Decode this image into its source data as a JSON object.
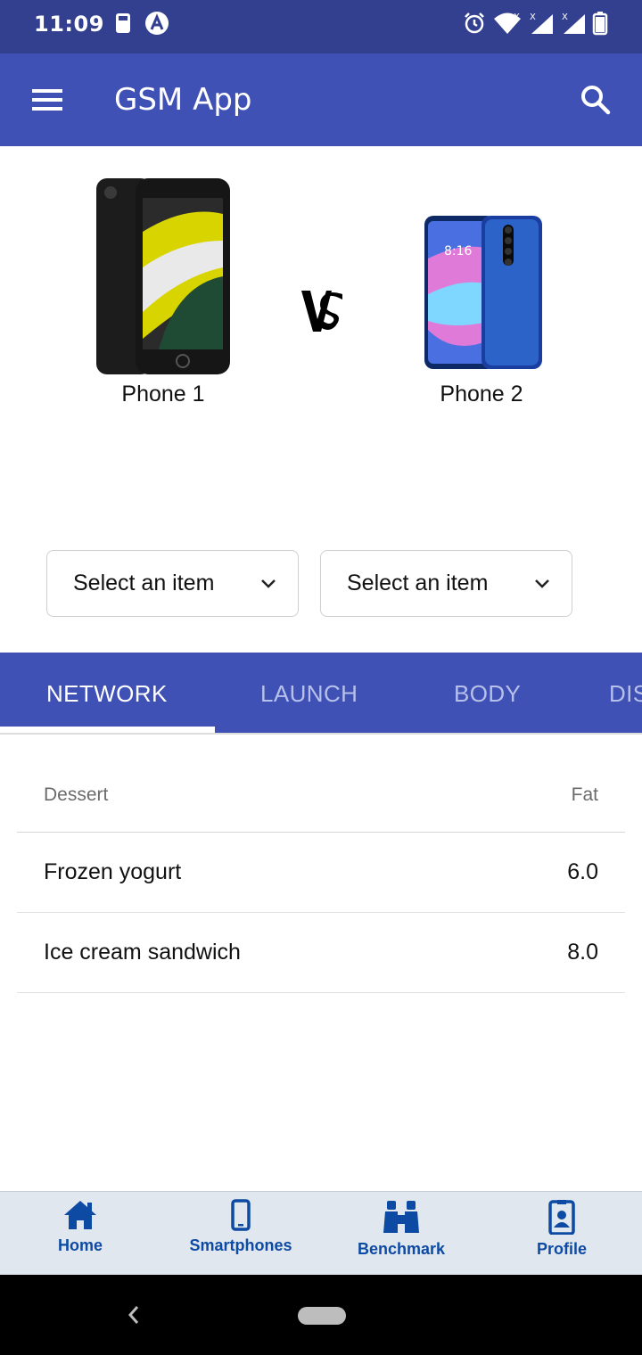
{
  "status_bar": {
    "time": "11:09",
    "icons": [
      "sim-card-icon",
      "a-circle-icon",
      "alarm-icon",
      "wifi-icon",
      "signal-x-icon",
      "signal-x-icon",
      "battery-icon"
    ]
  },
  "app_bar": {
    "title": "GSM App",
    "color": "#3f51b5",
    "status_color": "#33408f"
  },
  "comparison": {
    "phone1_label": "Phone 1",
    "phone2_label": "Phone 2"
  },
  "selects": {
    "left": "Select an item",
    "right": "Select an item"
  },
  "tabs": [
    {
      "label": "NETWORK",
      "active": true
    },
    {
      "label": "LAUNCH",
      "active": false
    },
    {
      "label": "BODY",
      "active": false
    },
    {
      "label": "DISPLAY",
      "active": false
    }
  ],
  "table": {
    "headers": {
      "left": "Dessert",
      "right": "Fat"
    },
    "rows": [
      {
        "name": "Frozen yogurt",
        "value": "6.0"
      },
      {
        "name": "Ice cream sandwich",
        "value": "8.0"
      }
    ]
  },
  "bottom_nav": [
    {
      "label": "Home",
      "icon": "home-icon"
    },
    {
      "label": "Smartphones",
      "icon": "smartphone-icon"
    },
    {
      "label": "Benchmark",
      "icon": "binoculars-icon"
    },
    {
      "label": "Profile",
      "icon": "profile-badge-icon"
    }
  ]
}
